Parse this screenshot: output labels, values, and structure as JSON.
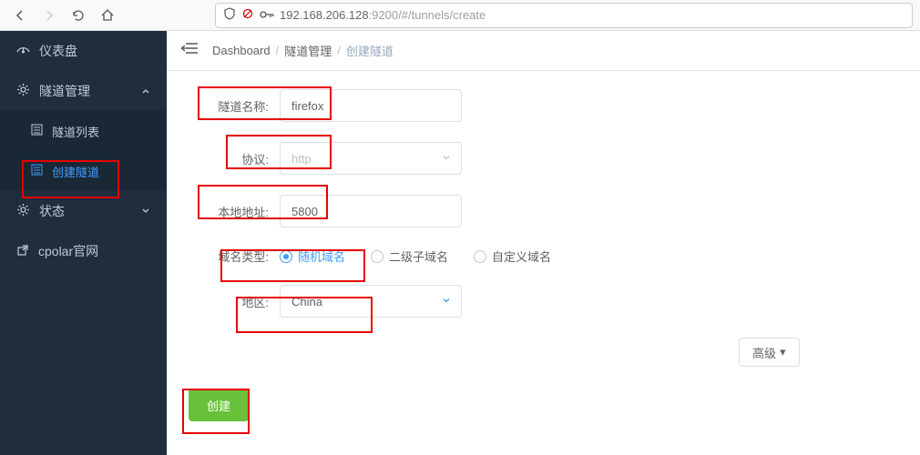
{
  "browser": {
    "url_host": "192.168.206.128",
    "url_port_path": ":9200/#/tunnels/create",
    "shield_icon": "shield",
    "key_icon": "key"
  },
  "sidebar": {
    "items": [
      {
        "label": "仪表盘"
      },
      {
        "label": "隧道管理"
      },
      {
        "label": "状态"
      },
      {
        "label": "cpolar官网"
      }
    ],
    "subitems": [
      {
        "label": "隧道列表",
        "active": false
      },
      {
        "label": "创建隧道",
        "active": true
      }
    ]
  },
  "breadcrumb": {
    "root": "Dashboard",
    "l1": "隧道管理",
    "l2": "创建隧道"
  },
  "form": {
    "name_label": "隧道名称:",
    "name_value": "firefox",
    "proto_label": "协议:",
    "proto_value": "http",
    "local_label": "本地地址:",
    "local_value": "5800",
    "domain_type_label": "域名类型:",
    "domain_types": [
      {
        "label": "随机域名",
        "selected": true
      },
      {
        "label": "二级子域名",
        "selected": false
      },
      {
        "label": "自定义域名",
        "selected": false
      }
    ],
    "region_label": "地区:",
    "region_value": "China",
    "advanced_label": "高级",
    "create_label": "创建"
  }
}
